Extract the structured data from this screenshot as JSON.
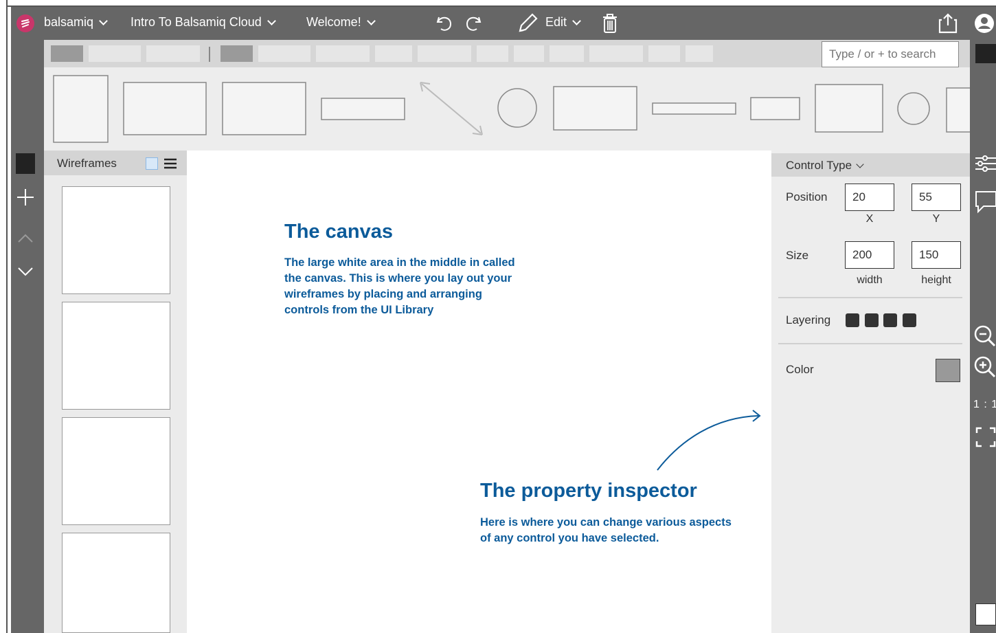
{
  "topbar": {
    "app_menu": "balsamiq",
    "project_menu": "Intro To Balsamiq Cloud",
    "page_menu": "Welcome!",
    "edit_menu": "Edit",
    "icons": [
      "undo-icon",
      "redo-icon",
      "pencil-icon",
      "trash-icon",
      "share-icon",
      "user-icon"
    ]
  },
  "search": {
    "placeholder": "Type / or + to search"
  },
  "wireframes_panel": {
    "title": "Wireframes",
    "thumbnail_count": 4
  },
  "canvas": {
    "note1": {
      "title": "The canvas",
      "body": "The large white area in the middle in called the canvas. This is where you lay out your wireframes by placing and arranging controls from the UI Library"
    },
    "note2": {
      "title": "The property inspector",
      "body": "Here is where you can change various aspects of any control you have selected."
    }
  },
  "inspector": {
    "control_type": "Control Type",
    "position_label": "Position",
    "position_x": "20",
    "position_y": "55",
    "x_label": "X",
    "y_label": "Y",
    "size_label": "Size",
    "width_value": "200",
    "height_value": "150",
    "width_label": "width",
    "height_label": "height",
    "layering_label": "Layering",
    "color_label": "Color",
    "color_value": "#999999"
  },
  "right_rail": {
    "zoom_reset": "1 : 1"
  },
  "colors": {
    "chrome": "#666666",
    "note_blue": "#0c5b9a",
    "logo": "#c9366a"
  }
}
